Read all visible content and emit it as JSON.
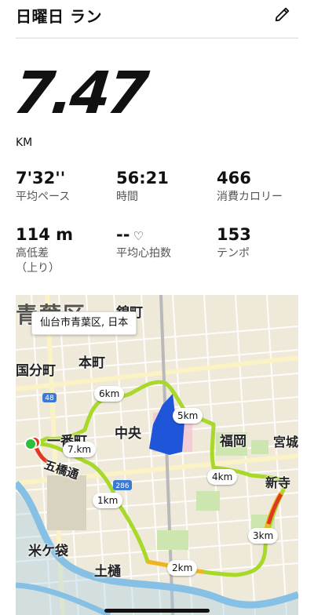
{
  "header": {
    "title": "日曜日 ラン"
  },
  "summary": {
    "distance": "7.47",
    "unit": "KM"
  },
  "stats": {
    "pace": {
      "value": "7'32''",
      "label": "平均ペース"
    },
    "time": {
      "value": "56:21",
      "label": "時間"
    },
    "calories": {
      "value": "466",
      "label": "消費カロリー"
    },
    "elevation": {
      "value": "114 m",
      "label": "高低差",
      "sublabel": "（上り）"
    },
    "heart_rate": {
      "value": "--",
      "label": "平均心拍数"
    },
    "cadence": {
      "value": "153",
      "label": "テンポ"
    }
  },
  "map": {
    "location_popup": "仙台市青葉区, 日本",
    "km_markers": [
      "1km",
      "2km",
      "3km",
      "4km",
      "5km",
      "6km",
      "7.km"
    ],
    "place_labels": {
      "aoba_ku": "青葉区",
      "kitamachi": "錦町",
      "kokubuncho": "国分町",
      "honcho": "本町",
      "ichibancho": "一番町",
      "chuo": "中央",
      "fukuoka": "福岡",
      "miyagi": "宮城",
      "shinji": "新寺",
      "itsutsubashi": "五橋通",
      "yonegafukuro": "米ケ袋",
      "dobashi": "土樋"
    },
    "road_badges": [
      "48",
      "286"
    ],
    "route_colors": {
      "main": "#a8d82a",
      "medium": "#f0b41e",
      "fast": "#e03a1e",
      "start": "#2bbf3a"
    }
  },
  "icons": {
    "edit": "pencil-icon",
    "heart": "heart-icon"
  }
}
